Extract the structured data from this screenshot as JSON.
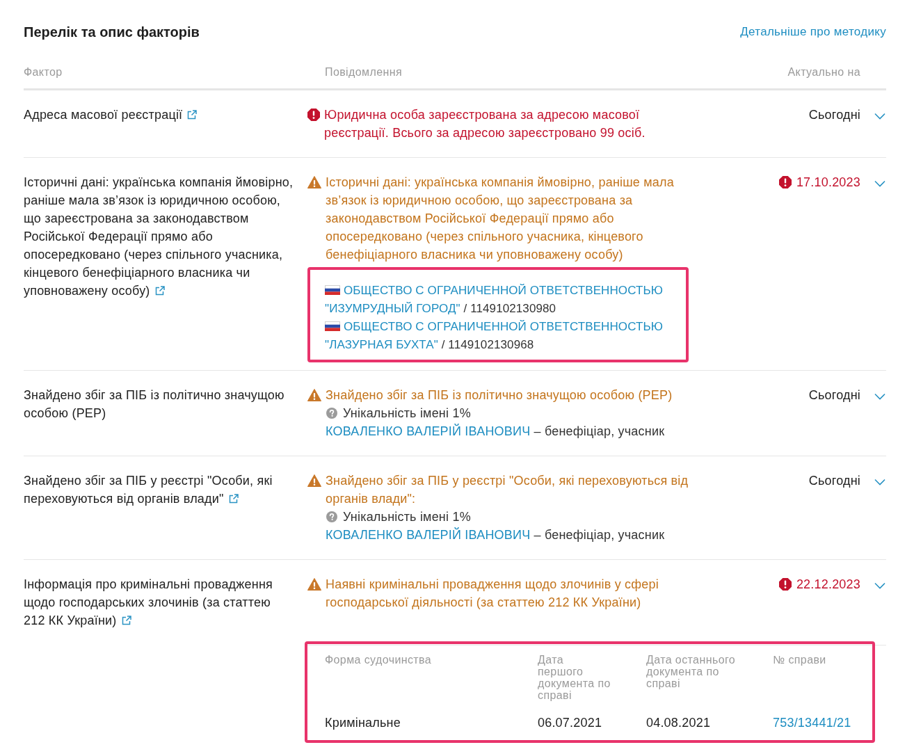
{
  "header": {
    "title": "Перелік та опис факторів",
    "link": "Детальніше про методику"
  },
  "table": {
    "columns": [
      "Фактор",
      "Повідомлення",
      "Актуально на"
    ],
    "rows": [
      {
        "factor": "Адреса масової реєстрації",
        "factor_link": true,
        "kind": "error",
        "message": "Юридична особа зареєстрована за адресою масової реєстрації. Всього за адресою зареєстровано 99 осіб.",
        "date": "Сьогодні",
        "date_alert": false
      },
      {
        "factor": "Історичні дані: українська компанія ймовірно, раніше мала зв’язок із юридичною особою, що зареєстрована за законодавством Російської Федерації прямо або опосередковано (через спільного учасника, кінцевого бенефіціарного власника чи уповноважену особу)",
        "factor_link": true,
        "kind": "warning",
        "message": "Історичні дані: українська компанія ймовірно, раніше мала зв’язок із юридичною особою, що зареєстрована за законодавством Російської Федерації прямо або опосередковано (через спільного учасника, кінцевого бенефіціарного власника чи уповноважену особу)",
        "companies": {
          "highlighted": true,
          "items": [
            {
              "name": "ОБЩЕСТВО С ОГРАНИЧЕННОЙ ОТВЕТСТВЕННОСТЬЮ \"ИЗУМРУДНЫЙ ГОРОД\"",
              "code": "/ 1149102130980"
            },
            {
              "name": "ОБЩЕСТВО С ОГРАНИЧЕННОЙ ОТВЕТСТВЕННОСТЬЮ \"ЛАЗУРНАЯ БУХТА\"",
              "code": "/ 1149102130968"
            }
          ]
        },
        "date": "17.10.2023",
        "date_alert": true
      },
      {
        "factor": "Знайдено збіг за ПІБ із політично значущою особою (PEP)",
        "factor_link": false,
        "kind": "warning",
        "message": "Знайдено збіг за ПІБ із політично значущою особою (PEP)",
        "uniqueness": "Унікальність імені 1%",
        "person": {
          "name": "КОВАЛЕНКО ВАЛЕРІЙ ІВАНОВИЧ",
          "role": "– бенефіціар, учасник"
        },
        "date": "Сьогодні",
        "date_alert": false
      },
      {
        "factor": "Знайдено збіг за ПІБ у реєстрі \"Особи, які переховуються від органів влади\"",
        "factor_link": true,
        "kind": "warning",
        "message": "Знайдено збіг за ПІБ у реєстрі \"Особи, які переховуються від органів влади\":",
        "uniqueness": "Унікальність імені 1%",
        "person": {
          "name": "КОВАЛЕНКО ВАЛЕРІЙ ІВАНОВИЧ",
          "role": "– бенефіціар, учасник"
        },
        "date": "Сьогодні",
        "date_alert": false
      },
      {
        "factor": "Інформація про кримінальні провадження щодо господарських злочинів (за статтею 212 КК України)",
        "factor_link": true,
        "kind": "warning",
        "message": "Наявні кримінальні провадження щодо злочинів у сфері господарської діяльності (за статтею 212 КК України)",
        "cases": {
          "highlighted": true,
          "columns": [
            "Форма судочинства",
            "Дата першого документа по справі",
            "Дата останнього документа по справі",
            "№ справи"
          ],
          "rows": [
            {
              "form": "Кримінальне",
              "first_date": "06.07.2021",
              "last_date": "04.08.2021",
              "case_number": "753/13441/21"
            }
          ]
        },
        "date": "22.12.2023",
        "date_alert": true
      }
    ]
  }
}
